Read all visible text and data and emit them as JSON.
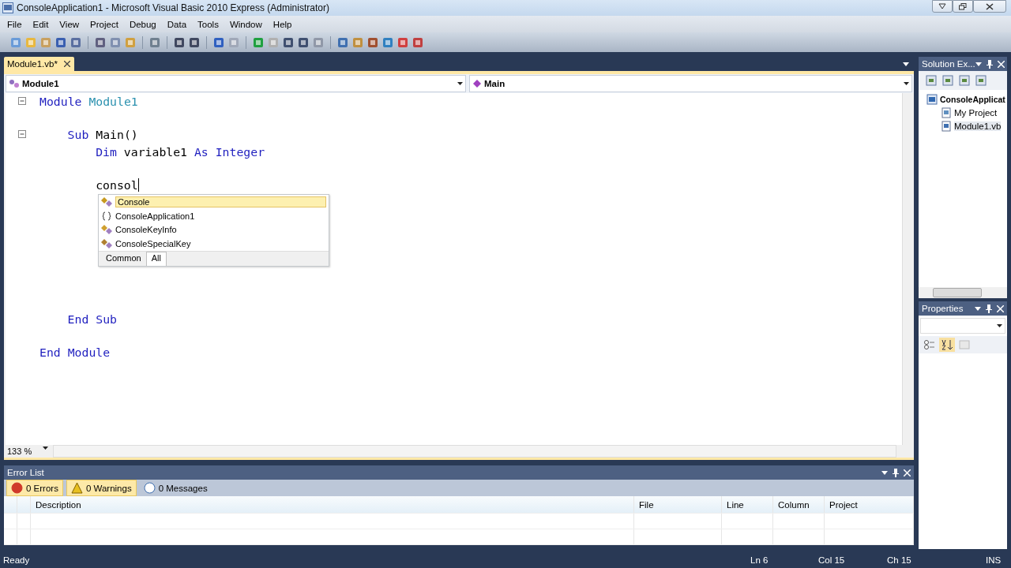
{
  "window": {
    "title": "ConsoleApplication1 - Microsoft Visual Basic 2010 Express (Administrator)"
  },
  "menu": [
    "File",
    "Edit",
    "View",
    "Project",
    "Debug",
    "Data",
    "Tools",
    "Window",
    "Help"
  ],
  "document_tab": {
    "label": "Module1.vb*",
    "selected": true
  },
  "navigation": {
    "type_dropdown": "Module1",
    "member_dropdown": "Main"
  },
  "code": [
    {
      "kind": "code",
      "fold": true,
      "tokens": [
        {
          "text": "Module",
          "kind": "keyword"
        },
        {
          "text": "Module1",
          "kind": "type"
        }
      ],
      "children": [
        {
          "kind": "blank"
        },
        {
          "kind": "code",
          "fold": true,
          "tokens": [
            {
              "text": "Sub",
              "kind": "keyword"
            },
            {
              "text": "Main()",
              "kind": "plain"
            }
          ],
          "children": [
            {
              "kind": "code",
              "tokens": [
                {
                  "text": "Dim",
                  "kind": "keyword"
                },
                {
                  "text": "variable1",
                  "kind": "plain"
                },
                {
                  "text": "As",
                  "kind": "keyword"
                },
                {
                  "text": "Integer",
                  "kind": "keyword"
                }
              ]
            },
            {
              "kind": "blank"
            },
            {
              "kind": "code",
              "caret": true,
              "tokens": [
                {
                  "text": "consol",
                  "kind": "plain"
                }
              ]
            },
            {
              "kind": "blank"
            },
            {
              "kind": "blank"
            },
            {
              "kind": "blank"
            },
            {
              "kind": "blank"
            },
            {
              "kind": "blank"
            },
            {
              "kind": "blank"
            },
            {
              "kind": "blank"
            }
          ]
        },
        {
          "kind": "code",
          "tokens": [
            {
              "text": "End",
              "kind": "keyword"
            },
            {
              "text": "Sub",
              "kind": "keyword"
            }
          ]
        },
        {
          "kind": "blank"
        }
      ]
    },
    {
      "kind": "code",
      "tokens": [
        {
          "text": "End",
          "kind": "keyword"
        },
        {
          "text": "Module",
          "kind": "keyword"
        }
      ]
    }
  ],
  "completion": {
    "items": [
      {
        "label": "Console",
        "kind": "class",
        "selected": true
      },
      {
        "label": "ConsoleApplication1",
        "kind": "namespace",
        "selected": false
      },
      {
        "label": "ConsoleKeyInfo",
        "kind": "structure",
        "selected": false
      },
      {
        "label": "ConsoleSpecialKey",
        "kind": "enum",
        "selected": false
      }
    ],
    "tabs": [
      {
        "label": "Common",
        "selected": false
      },
      {
        "label": "All",
        "selected": true
      }
    ]
  },
  "zoom": "133 %",
  "solution_explorer": {
    "title": "Solution Ex...",
    "tree": [
      {
        "label": "ConsoleApplicat",
        "kind": "project",
        "children": [
          {
            "label": "My Project",
            "kind": "settings",
            "selected": false
          },
          {
            "label": "Module1.vb",
            "kind": "file",
            "selected": true
          }
        ]
      }
    ]
  },
  "properties": {
    "title": "Properties"
  },
  "error_list": {
    "title": "Error List",
    "filters": [
      {
        "label": "0 Errors",
        "kind": "error",
        "selected": true
      },
      {
        "label": "0 Warnings",
        "kind": "warning",
        "selected": true
      },
      {
        "label": "0 Messages",
        "kind": "info",
        "selected": false
      }
    ],
    "columns": [
      "Description",
      "File",
      "Line",
      "Column",
      "Project"
    ]
  },
  "status_bar": {
    "message": "Ready",
    "line": "Ln 6",
    "column": "Col 15",
    "char": "Ch 15",
    "mode": "INS"
  }
}
